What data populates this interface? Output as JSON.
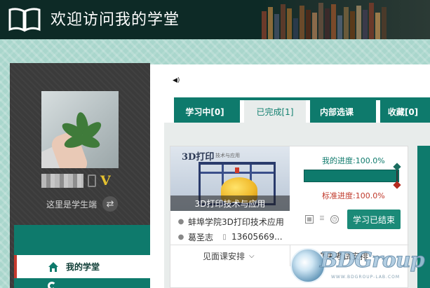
{
  "header": {
    "site_title": "欢迎访问我的学堂",
    "logo_icon": "open-book-icon"
  },
  "sidebar": {
    "role_text": "这里是学生端",
    "vip_badge": "V",
    "nav": [
      {
        "label": "我的学堂",
        "icon": "home-icon",
        "active": true
      }
    ]
  },
  "main": {
    "tabs": [
      {
        "label": "学习中[0]",
        "active": false
      },
      {
        "label": "已完成[1]",
        "active": true
      },
      {
        "label": "内部选课",
        "active": false
      },
      {
        "label": "收藏[0]",
        "active": false
      }
    ],
    "course": {
      "thumb_heading": "3D打印",
      "thumb_sub": "技术与应用",
      "thumb_title": "3D打印技术与应用",
      "full_name": "蚌埠学院3D打印技术应用",
      "teacher": "葛圣志",
      "phone": "13605669...",
      "my_progress_label": "我的进度:100.0%",
      "my_progress": 1.0,
      "std_progress_label": "标准进度:100.0%",
      "std_progress": 1.0,
      "status_button": "学习已结束",
      "footer_left": "见面课安排",
      "footer_right": "期末考试安排"
    }
  },
  "watermark": {
    "brand": "BDGroup",
    "url": "WWW.BDGROUP-LAB.COM"
  },
  "colors": {
    "header_bg": "#0d2a26",
    "accent_green": "#0e7a6c",
    "button_green": "#1b8a78",
    "std_red": "#c0392b",
    "active_marker_red": "#c53a2d",
    "vip_gold": "#e5c230"
  }
}
